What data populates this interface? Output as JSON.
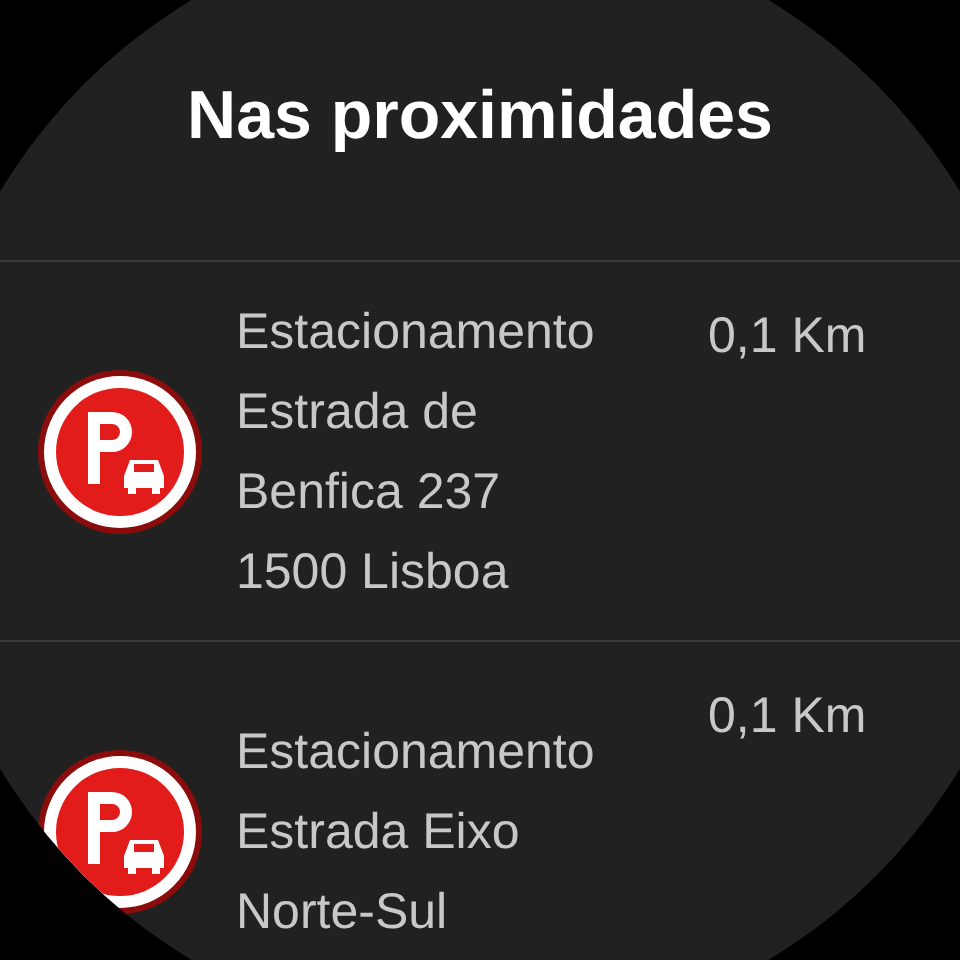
{
  "title": "Nas proximidades",
  "places": [
    {
      "name": "Estacionamento",
      "address": [
        "Estrada de",
        "Benfica 237",
        "1500 Lisboa"
      ],
      "distance": "0,1 Km"
    },
    {
      "name": "Estacionamento",
      "address": [
        "Estrada Eixo",
        "Norte-Sul"
      ],
      "distance": "0,1 Km"
    }
  ]
}
